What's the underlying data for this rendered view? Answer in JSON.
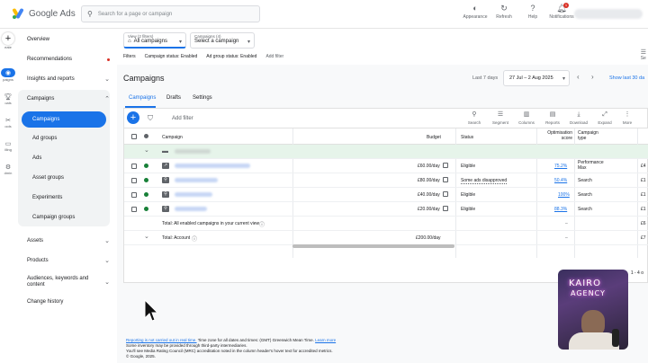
{
  "app": {
    "name": "Google Ads"
  },
  "search": {
    "placeholder": "Search for a page or campaign"
  },
  "topbar": {
    "items": [
      {
        "label": "Appearance",
        "icon": "appearance-icon"
      },
      {
        "label": "Refresh",
        "icon": "refresh-icon"
      },
      {
        "label": "Help",
        "icon": "help-icon"
      },
      {
        "label": "Notifications",
        "icon": "bell-icon",
        "badge": "1"
      }
    ]
  },
  "rail": {
    "create_label": "eate",
    "campaigns_label": "paigns",
    "goals_label": "oals",
    "tools_label": "ools",
    "billing_label": "illing",
    "admin_label": "dmin"
  },
  "sidenav": {
    "overview": "Overview",
    "recommendations": "Recommendations",
    "insights": "Insights and reports",
    "campaigns": "Campaigns",
    "sub": [
      "Campaigns",
      "Ad groups",
      "Ads",
      "Asset groups",
      "Experiments",
      "Campaign groups"
    ],
    "assets": "Assets",
    "products": "Products",
    "audiences": "Audiences, keywords and content",
    "change_history": "Change history"
  },
  "filterbar": {
    "view_small": "View (2 filters)",
    "view_value": "All campaigns",
    "campaigns_small": "Campaigns (4)",
    "campaigns_value": "Select a campaign",
    "filters_label": "Filters",
    "filter1": "Campaign status: Enabled",
    "filter2": "Ad group status: Enabled",
    "add_filter": "Add filter",
    "segment_label": "Se"
  },
  "pagehead": {
    "title": "Campaigns",
    "range_label": "Last 7 days",
    "date_range": "27 Jul – 2 Aug 2025",
    "show_last": "Show last 30 da"
  },
  "tabs": [
    "Campaigns",
    "Drafts",
    "Settings"
  ],
  "toolbar": {
    "add_filter": "Add filter",
    "tools": [
      {
        "label": "Search",
        "icon": "search-icon",
        "glyph": "⚲"
      },
      {
        "label": "Segment",
        "icon": "segment-icon",
        "glyph": "☰"
      },
      {
        "label": "Columns",
        "icon": "columns-icon",
        "glyph": "▥"
      },
      {
        "label": "Reports",
        "icon": "reports-icon",
        "glyph": "▤"
      },
      {
        "label": "Download",
        "icon": "download-icon",
        "glyph": "⤓"
      },
      {
        "label": "Expand",
        "icon": "expand-icon",
        "glyph": "⤢"
      },
      {
        "label": "More",
        "icon": "more-icon",
        "glyph": "⋮"
      }
    ]
  },
  "table": {
    "headers": {
      "campaign": "Campaign",
      "budget": "Budget",
      "status": "Status",
      "opt_score": "Optimisation score",
      "camp_type": "Campaign type"
    },
    "rows": [
      {
        "budget": "£60.00/day",
        "status": "Eligible",
        "opt": "75.2%",
        "type": "Performance Max",
        "extra": "£4"
      },
      {
        "budget": "£80.00/day",
        "status": "Some ads disapproved",
        "opt": "50.4%",
        "type": "Search",
        "extra": "£1"
      },
      {
        "budget": "£40.00/day",
        "status": "Eligible",
        "opt": "100%",
        "type": "Search",
        "extra": "£1"
      },
      {
        "budget": "£20.00/day",
        "status": "Eligible",
        "opt": "88.3%",
        "type": "Search",
        "extra": "£1"
      }
    ],
    "total_enabled": "Total: All enabled campaigns in your current view",
    "total_enabled_opt": "–",
    "total_enabled_extra": "£6",
    "total_account": "Total: Account",
    "total_account_budget": "£200.00/day",
    "total_account_opt": "–",
    "total_account_extra": "£7",
    "pager": "1 - 4 o"
  },
  "footer": {
    "line1_link1": "Reporting is not carried out in real time.",
    "line1_text": " Time zone for all dates and times: (GMT) Greenwich Mean Time.",
    "line1_link2": "Learn more",
    "line2": "Some inventory may be provided through third-party intermediaries.",
    "line3": "You'll see Media Rating Council (MRC) accreditation noted in the column header's hover text for accredited metrics.",
    "line4": "© Google, 2025."
  },
  "overlay": {
    "brand_line1": "KAIRO",
    "brand_line2": "AGENCY"
  },
  "colors": {
    "accent": "#1a73e8",
    "enabled": "#188038",
    "disapproved": "#d93025"
  }
}
